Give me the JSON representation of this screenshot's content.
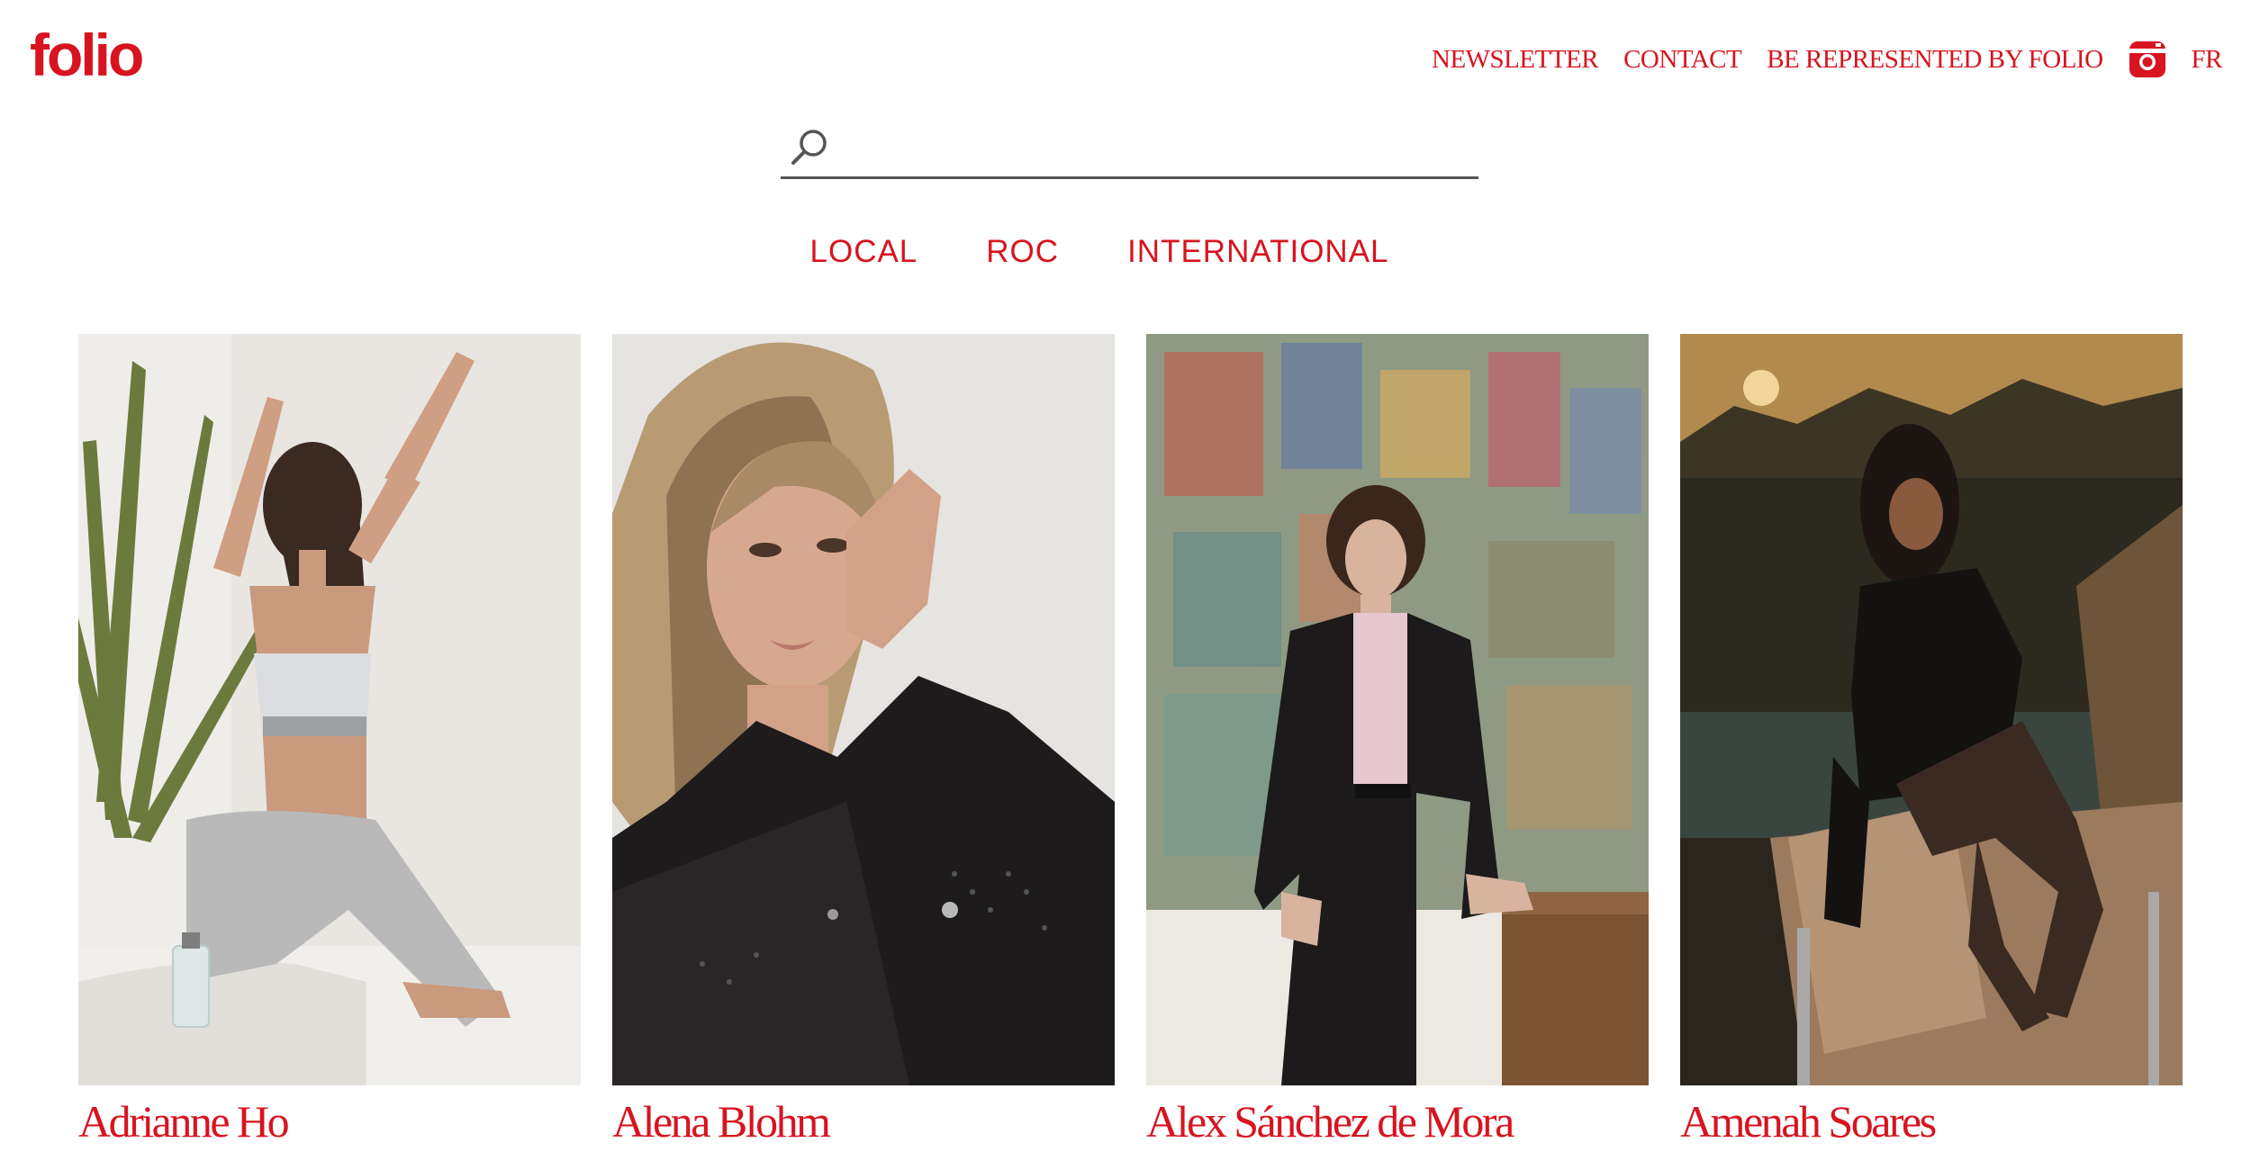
{
  "brand": {
    "logo_text": "folio",
    "accent_color": "#d7141f"
  },
  "nav": {
    "newsletter": "NEWSLETTER",
    "contact": "CONTACT",
    "represent": "BE REPRESENTED BY FOLIO",
    "instagram_icon": "instagram-icon",
    "language": "FR"
  },
  "search": {
    "value": "",
    "placeholder": "",
    "icon": "search-icon"
  },
  "filters": [
    "LOCAL",
    "ROC",
    "INTERNATIONAL"
  ],
  "models": [
    {
      "name": "Adrianne Ho"
    },
    {
      "name": "Alena Blohm"
    },
    {
      "name": "Alex Sánchez de Mora"
    },
    {
      "name": "Amenah Soares"
    }
  ]
}
